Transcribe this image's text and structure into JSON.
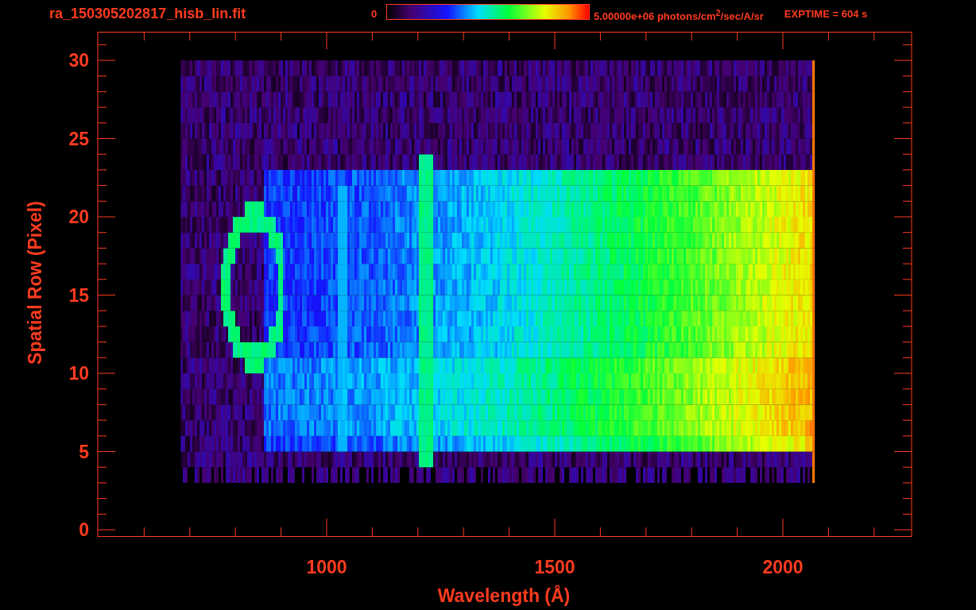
{
  "header": {
    "title": "ra_150305202817_hisb_lin.fit",
    "colorbar": {
      "min_label": "0",
      "max_label": "5.00000e+06 photons/cm$^{2}$/sec/A/sr"
    },
    "exposure": "EXPTIME = 604 s"
  },
  "plot": {
    "xlabel": "Wavelength (Å)",
    "ylabel": "Spatial Row (Pixel)",
    "xticks": [
      "1000",
      "1500",
      "2000"
    ],
    "yticks": [
      "30",
      "25",
      "20",
      "15",
      "10",
      "5",
      "0"
    ]
  }
}
